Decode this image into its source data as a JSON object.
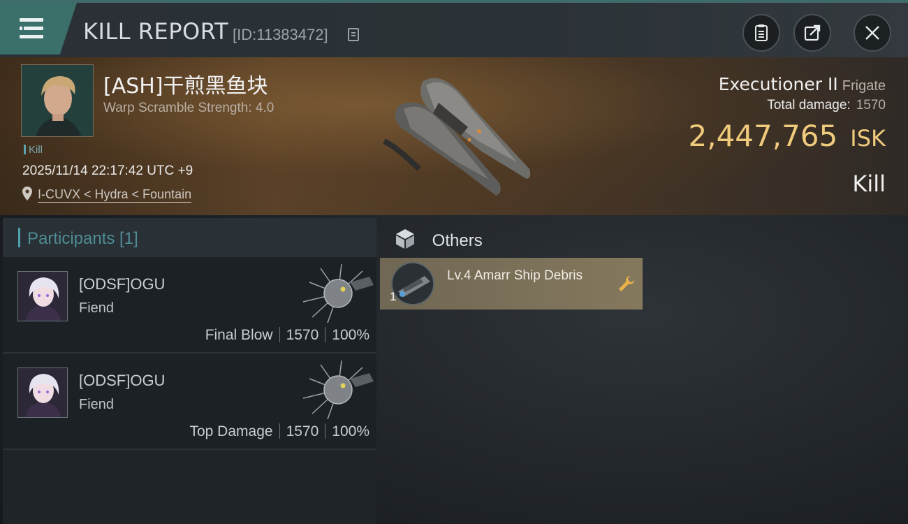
{
  "header": {
    "title": "KILL REPORT",
    "report_id": "[ID:11383472]"
  },
  "victim": {
    "name": "[ASH]干煎黑鱼块",
    "warp_scramble": "Warp Scramble Strength: 4.0",
    "tag": "Kill",
    "datetime": "2025/11/14 22:17:42 UTC +9",
    "location": "I-CUVX < Hydra < Fountain"
  },
  "ship": {
    "name": "Executioner II",
    "class": "Frigate",
    "total_damage_label": "Total damage:",
    "total_damage": "1570",
    "isk_value": "2,447,765",
    "isk_unit": "ISK",
    "result": "Kill"
  },
  "participants": {
    "label": "Participants [1]",
    "rows": [
      {
        "name": "[ODSF]OGU",
        "corp": "Fiend",
        "role": "Final Blow",
        "damage": "1570",
        "percent": "100%"
      },
      {
        "name": "[ODSF]OGU",
        "corp": "Fiend",
        "role": "Top Damage",
        "damage": "1570",
        "percent": "100%"
      }
    ]
  },
  "others": {
    "label": "Others",
    "items": [
      {
        "name": "Lv.4 Amarr Ship Debris",
        "qty": "1"
      }
    ]
  },
  "colors": {
    "accent": "#3a6f6a",
    "isk": "#f1cb7c",
    "participants_label": "#4e8d93"
  },
  "icons": [
    "menu-icon",
    "copy-icon",
    "clipboard-icon",
    "share-icon",
    "close-icon",
    "location-pin-icon",
    "cube-icon",
    "wrench-icon"
  ]
}
